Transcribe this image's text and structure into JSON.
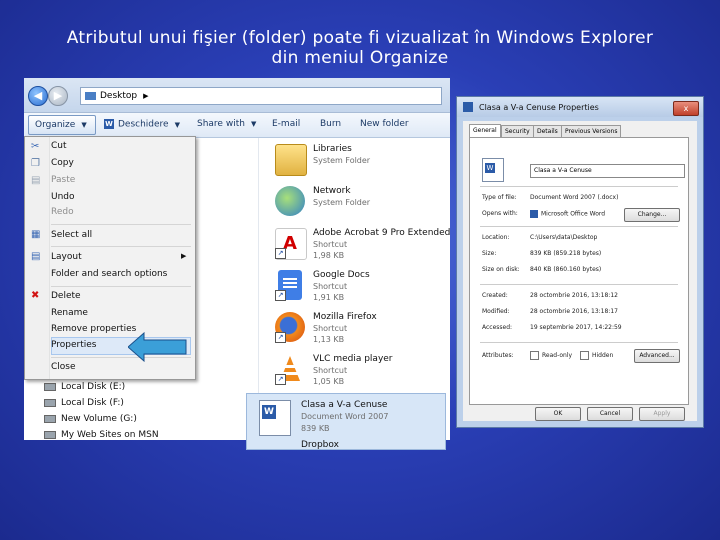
{
  "slide": {
    "title_line1": "Atributul unui fişier (folder) poate fi vizualizat în Windows Explorer",
    "title_line2": "din meniul Organize"
  },
  "explorer": {
    "address": "Desktop",
    "toolbar": {
      "organize": "Organize",
      "open": "Deschidere",
      "share": "Share with",
      "email": "E-mail",
      "burn": "Burn",
      "new_folder": "New folder"
    },
    "organize_menu": {
      "items": [
        {
          "label": "Cut",
          "icon": "scissors-icon",
          "enabled": true
        },
        {
          "label": "Copy",
          "icon": "copy-icon",
          "enabled": true
        },
        {
          "label": "Paste",
          "icon": "paste-icon",
          "enabled": false
        },
        {
          "label": "Undo",
          "enabled": true
        },
        {
          "label": "Redo",
          "enabled": false
        },
        {
          "label": "Select all",
          "icon": "select-all-icon",
          "enabled": true
        },
        {
          "label": "Layout",
          "icon": "layout-icon",
          "enabled": true,
          "submenu": true
        },
        {
          "label": "Folder and search options",
          "enabled": true
        },
        {
          "label": "Delete",
          "icon": "delete-icon",
          "enabled": true
        },
        {
          "label": "Rename",
          "enabled": true
        },
        {
          "label": "Remove properties",
          "enabled": true
        },
        {
          "label": "Properties",
          "enabled": true,
          "highlighted": true
        },
        {
          "label": "Close",
          "enabled": true
        }
      ]
    },
    "drives": [
      "Local Disk (E:)",
      "Local Disk (F:)",
      "New Volume (G:)",
      "My Web Sites on MSN"
    ],
    "items": [
      {
        "name": "Libraries",
        "type": "System Folder",
        "icon": "libraries-icon"
      },
      {
        "name": "Network",
        "type": "System Folder",
        "icon": "network-icon"
      },
      {
        "name": "Adobe Acrobat 9 Pro Extended",
        "type": "Shortcut",
        "size": "1,98 KB",
        "icon": "acrobat-icon"
      },
      {
        "name": "Google Docs",
        "type": "Shortcut",
        "size": "1,91 KB",
        "icon": "google-docs-icon"
      },
      {
        "name": "Mozilla Firefox",
        "type": "Shortcut",
        "size": "1,13 KB",
        "icon": "firefox-icon"
      },
      {
        "name": "VLC media player",
        "type": "Shortcut",
        "size": "1,05 KB",
        "icon": "vlc-icon"
      }
    ],
    "selected_item": {
      "name": "Clasa a V-a Cenuse",
      "type": "Document Word 2007",
      "size": "839 KB",
      "next": "Dropbox"
    }
  },
  "properties_dialog": {
    "title": "Clasa a V-a Cenuse Properties",
    "close": "x",
    "tabs": [
      "General",
      "Security",
      "Details",
      "Previous Versions"
    ],
    "file_name": "Clasa a V-a Cenuse",
    "rows": [
      {
        "label": "Type of file:",
        "value": "Document Word 2007 (.docx)"
      },
      {
        "label": "Opens with:",
        "value": "Microsoft Office Word"
      },
      {
        "label": "Location:",
        "value": "C:\\Users\\data\\Desktop"
      },
      {
        "label": "Size:",
        "value": "839 KB (859.218 bytes)"
      },
      {
        "label": "Size on disk:",
        "value": "840 KB (860.160 bytes)"
      },
      {
        "label": "Created:",
        "value": "28 octombrie 2016, 13:18:12"
      },
      {
        "label": "Modified:",
        "value": "28 octombrie 2016, 13:18:17"
      },
      {
        "label": "Accessed:",
        "value": "19 septembrie 2017, 14:22:59"
      }
    ],
    "attributes_label": "Attributes:",
    "readonly": "Read-only",
    "hidden": "Hidden",
    "change": "Change...",
    "advanced": "Advanced...",
    "ok": "OK",
    "cancel": "Cancel",
    "apply": "Apply"
  }
}
